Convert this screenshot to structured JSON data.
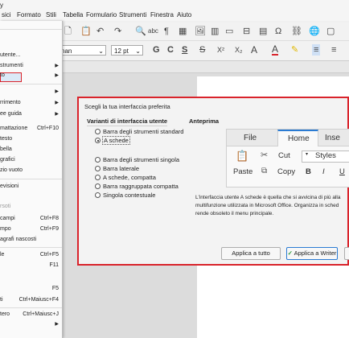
{
  "menubar": {
    "items": [
      "sici",
      "Formato",
      "Stili",
      "Tabella",
      "Formulario",
      "Strumenti",
      "Finestra",
      "Aiuto"
    ],
    "partial_left": "y"
  },
  "toolbar": {
    "font_name": "nan",
    "font_size": "12 pt",
    "format_buttons": [
      "G",
      "C",
      "S",
      "S",
      "X²",
      "X₂",
      "A",
      "A"
    ]
  },
  "menu": {
    "items": [
      {
        "label": "utente...",
        "shortcut": "",
        "submenu": false,
        "dim": false,
        "highlighted": true
      },
      {
        "label": "strumenti",
        "shortcut": "",
        "submenu": true,
        "dim": false
      },
      {
        "label": "to",
        "shortcut": "",
        "submenu": true,
        "dim": false
      },
      {
        "label": "",
        "shortcut": "",
        "submenu": true,
        "dim": false
      },
      {
        "label": "rrimento",
        "shortcut": "",
        "submenu": true,
        "dim": false
      },
      {
        "label": "ee guida",
        "shortcut": "",
        "submenu": true,
        "dim": false
      },
      {
        "label": "mattazione",
        "shortcut": "Ctrl+F10",
        "submenu": false,
        "dim": false
      },
      {
        "label": "testo",
        "shortcut": "",
        "submenu": false,
        "dim": false
      },
      {
        "label": "bella",
        "shortcut": "",
        "submenu": false,
        "dim": false
      },
      {
        "label": "grafici",
        "shortcut": "",
        "submenu": false,
        "dim": false
      },
      {
        "label": "zio vuoto",
        "shortcut": "",
        "submenu": false,
        "dim": false
      },
      {
        "label": "evisioni",
        "shortcut": "",
        "submenu": false,
        "dim": false
      },
      {
        "label": "rsoti",
        "shortcut": "",
        "submenu": false,
        "dim": true
      },
      {
        "label": "campi",
        "shortcut": "Ctrl+F8",
        "submenu": false,
        "dim": false
      },
      {
        "label": "mpo",
        "shortcut": "Ctrl+F9",
        "submenu": false,
        "dim": false
      },
      {
        "label": "agrafi nascosti",
        "shortcut": "",
        "submenu": false,
        "dim": false
      },
      {
        "label": "le",
        "shortcut": "Ctrl+F5",
        "submenu": false,
        "dim": false
      },
      {
        "label": "",
        "shortcut": "F11",
        "submenu": false,
        "dim": false
      },
      {
        "label": "",
        "shortcut": "F5",
        "submenu": false,
        "dim": false
      },
      {
        "label": "ti",
        "shortcut": "Ctrl+Maiusc+F4",
        "submenu": false,
        "dim": false
      },
      {
        "label": "tero",
        "shortcut": "Ctrl+Maiusc+J",
        "submenu": false,
        "dim": false
      },
      {
        "label": "",
        "shortcut": "",
        "submenu": true,
        "dim": false
      }
    ]
  },
  "dialog": {
    "title": "Scegli la tua interfaccia preferita",
    "variants_heading": "Varianti di interfaccia utente",
    "preview_heading": "Anteprima",
    "options": [
      {
        "label": "Barra degli strumenti standard",
        "selected": false
      },
      {
        "label": "A schede",
        "selected": true
      },
      {
        "label": "Barra degli strumenti singola",
        "selected": false
      },
      {
        "label": "Barra laterale",
        "selected": false
      },
      {
        "label": "A schede, compatta",
        "selected": false
      },
      {
        "label": "Barra raggruppata compatta",
        "selected": false
      },
      {
        "label": "Singola contestuale",
        "selected": false
      }
    ],
    "description": [
      "L'interfaccia utente A schede è quella che si avvicina di più alla",
      "multifunzione utilizzata in Microsoft Office. Organizza in sched",
      "rende obsoleto il menu principale."
    ],
    "buttons": {
      "apply_all": "Applica a tutto",
      "apply_writer": "Applica a Writer"
    }
  },
  "preview": {
    "tabs": [
      "File",
      "Home",
      "Inse"
    ],
    "cut": "Cut",
    "styles": "Styles",
    "paste": "Paste",
    "copy": "Copy",
    "bold": "B",
    "italic": "I",
    "underline": "U"
  },
  "colors": {
    "highlight_border": "#d9232b",
    "accent_blue": "#2a7bd3",
    "check_green": "#2e9b3a"
  }
}
